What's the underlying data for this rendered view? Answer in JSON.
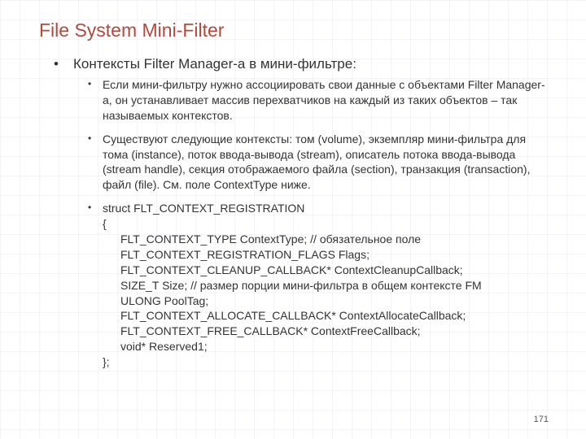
{
  "title": "File System Mini-Filter",
  "main_bullet": "Контексты Filter Manager-а в мини-фильтре:",
  "sub1": "Если мини-фильтру нужно ассоциировать свои данные с объектами Filter Manager-а, он устанавливает массив перехватчиков на каждый из таких объектов – так называемых контекстов.",
  "sub2": "Существуют следующие контексты: том (volume), экземпляр мини-фильтра для тома (instance), поток ввода-вывода (stream), описатель потока ввода-вывода (stream handle), секция отображаемого файла (section), транзакция (transaction), файл (file). См. поле ContextType ниже.",
  "struct_head": "struct FLT_CONTEXT_REGISTRATION",
  "struct_open": "{",
  "struct_lines": {
    "l1": "FLT_CONTEXT_TYPE ContextType; // обязательное поле",
    "l2": "FLT_CONTEXT_REGISTRATION_FLAGS Flags;",
    "l3": "FLT_CONTEXT_CLEANUP_CALLBACK* ContextCleanupCallback;",
    "l4": "SIZE_T Size; // размер порции мини-фильтра в общем контексте FM",
    "l5": "ULONG PoolTag;",
    "l6": "FLT_CONTEXT_ALLOCATE_CALLBACK* ContextAllocateCallback;",
    "l7": "FLT_CONTEXT_FREE_CALLBACK* ContextFreeCallback;",
    "l8": "void* Reserved1;"
  },
  "struct_close": "};",
  "page_number": "171"
}
